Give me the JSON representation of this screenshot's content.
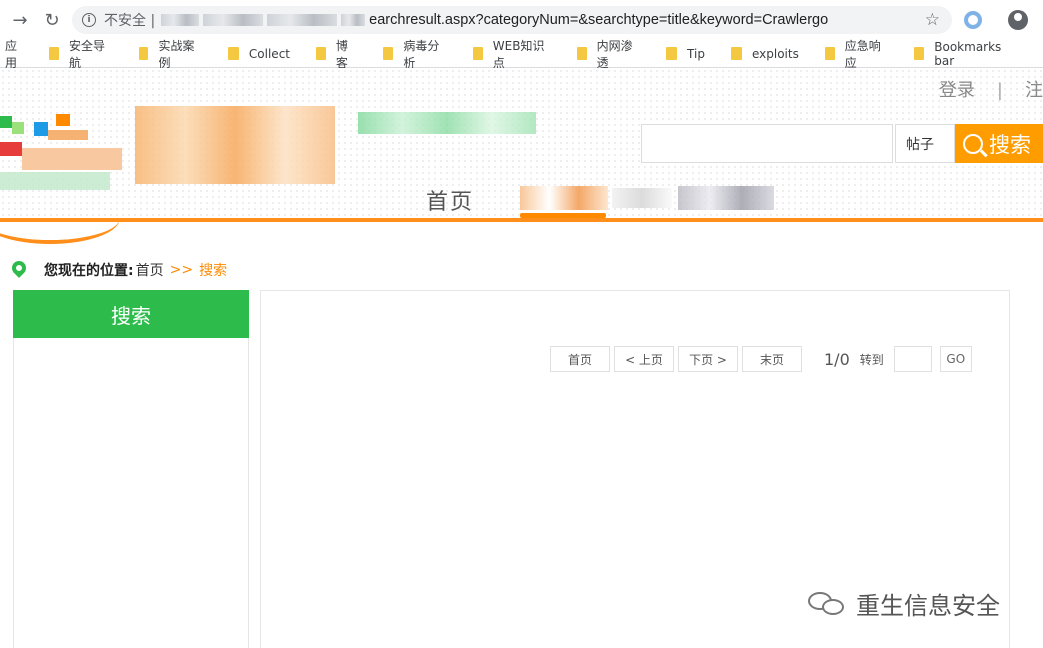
{
  "browser": {
    "insecure_label": "不安全 |",
    "url_visible": "earchresult.aspx?categoryNum=&searchtype=title&keyword=Crawlergo",
    "apps_label": "应用",
    "bookmarks": [
      "安全导航",
      "实战案例",
      "Collect",
      "博客",
      "病毒分析",
      "WEB知识点",
      "内网渗透",
      "Tip",
      "exploits",
      "应急响应",
      "Bookmarks bar"
    ]
  },
  "header": {
    "login": "登录",
    "separator": "|",
    "register": "注"
  },
  "search": {
    "type_label": "帖子",
    "button_label": "搜索"
  },
  "nav": {
    "home": "首页"
  },
  "breadcrumb": {
    "label": "您现在的位置:",
    "home": "首页",
    "arrow": ">>",
    "current": "搜索"
  },
  "sidebar": {
    "title": "搜索"
  },
  "pager": {
    "first": "首页",
    "prev": "< 上页",
    "next": "下页 >",
    "last": "末页",
    "count": "1/0",
    "goto_label": "转到",
    "go": "GO"
  },
  "watermark": {
    "text": "重生信息安全"
  },
  "colors": {
    "accent_orange": "#ff8a00",
    "accent_green": "#2dbb4b"
  }
}
